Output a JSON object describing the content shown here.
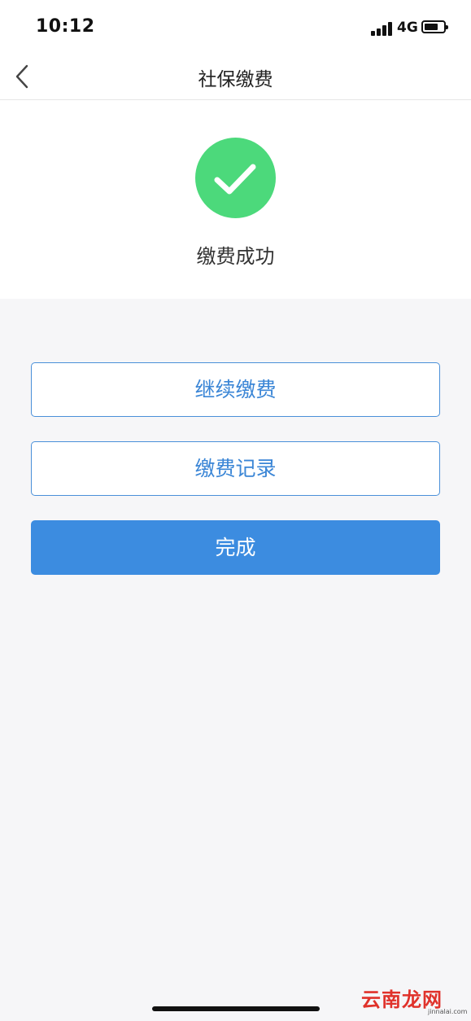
{
  "status_bar": {
    "time": "10:12",
    "network": "4G",
    "signal_bars": 4,
    "battery_level": 0.6
  },
  "nav": {
    "back_icon": "chevron-left-icon",
    "title": "社保缴费"
  },
  "result": {
    "icon": "success-check-icon",
    "icon_color": "#4cd97b",
    "message": "缴费成功"
  },
  "actions": {
    "continue_label": "继续缴费",
    "records_label": "缴费记录",
    "done_label": "完成"
  },
  "colors": {
    "primary": "#3c8ce0",
    "outline_text": "#3b86d6",
    "background": "#f6f6f8"
  },
  "watermark": {
    "main": "云南龙网",
    "sub": "jinnalai.com"
  }
}
